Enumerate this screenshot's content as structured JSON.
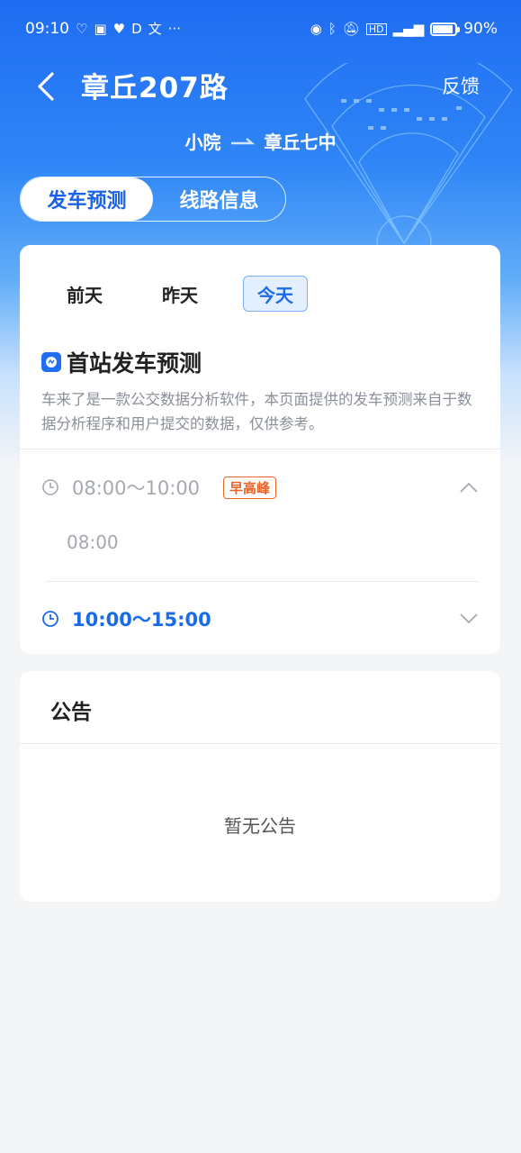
{
  "status_bar": {
    "time": "09:10",
    "battery": "90%",
    "left_icons": [
      "health-icon",
      "app-icon",
      "heart-icon",
      "d-icon",
      "translate-icon",
      "more-icon"
    ],
    "right_icons": [
      "eye-icon",
      "bluetooth-icon",
      "mute-icon",
      "hd-icon",
      "signal-5g-icon",
      "battery-icon"
    ]
  },
  "header": {
    "title": "章丘207路",
    "feedback_label": "反馈",
    "route_from": "小院",
    "route_to": "章丘七中"
  },
  "tabs": [
    {
      "label": "发车预测",
      "active": true
    },
    {
      "label": "线路信息",
      "active": false
    }
  ],
  "days": [
    {
      "label": "前天",
      "active": false
    },
    {
      "label": "昨天",
      "active": false
    },
    {
      "label": "今天",
      "active": true
    }
  ],
  "forecast": {
    "title": "首站发车预测",
    "description": "车来了是一款公交数据分析软件，本页面提供的发车预测来自于数据分析程序和用户提交的数据，仅供参考。",
    "periods": [
      {
        "range": "08:00～10:00",
        "badge": "早高峰",
        "expanded": true,
        "times": [
          "08:00"
        ]
      },
      {
        "range": "10:00～15:00",
        "badge": "",
        "expanded": false,
        "times": []
      }
    ]
  },
  "notice": {
    "title": "公告",
    "empty_text": "暂无公告"
  },
  "colors": {
    "accent": "#1a6be8",
    "peak": "#e8652a",
    "muted_text": "#a4a8b0"
  }
}
